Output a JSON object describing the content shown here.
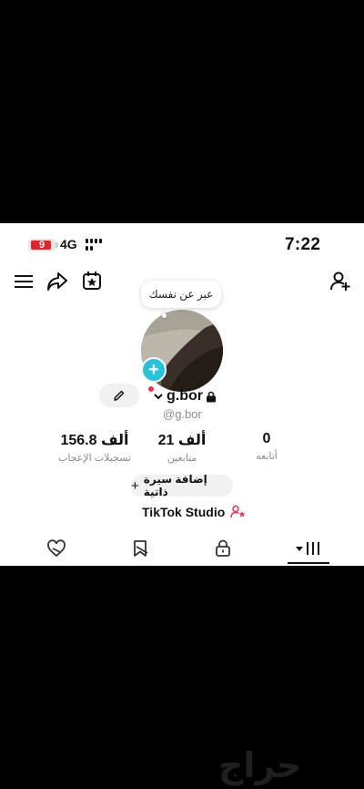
{
  "status_bar": {
    "battery_level": "9",
    "network": "4G",
    "time": "7:22"
  },
  "header": {
    "menu_icon": "hamburger-menu-icon",
    "share_icon": "share-arrow-icon",
    "calendar_icon": "calendar-star-icon",
    "add_friend_icon": "add-user-icon"
  },
  "profile": {
    "bio_tooltip": "عبر عن نفسك",
    "name": "g.bor",
    "handle": "@g.bor",
    "accent_color": "#fe2c55",
    "add_badge_color": "#25c4dd"
  },
  "stats": [
    {
      "value": "156.8 ألف",
      "label": "تسجيلات الإعجاب"
    },
    {
      "value": "21 ألف",
      "label": "متابعين"
    },
    {
      "value": "0",
      "label": "أتابعه"
    }
  ],
  "bio_button": {
    "icon": "+",
    "label": "إضافة سيرة ذاتية"
  },
  "studio_link": {
    "label": "TikTok Studio"
  },
  "tabs": [
    {
      "icon": "liked-heart-icon"
    },
    {
      "icon": "favorites-bookmark-icon"
    },
    {
      "icon": "private-lock-icon"
    },
    {
      "icon": "videos-grid-icon",
      "active": true
    }
  ],
  "watermark": "حراج"
}
